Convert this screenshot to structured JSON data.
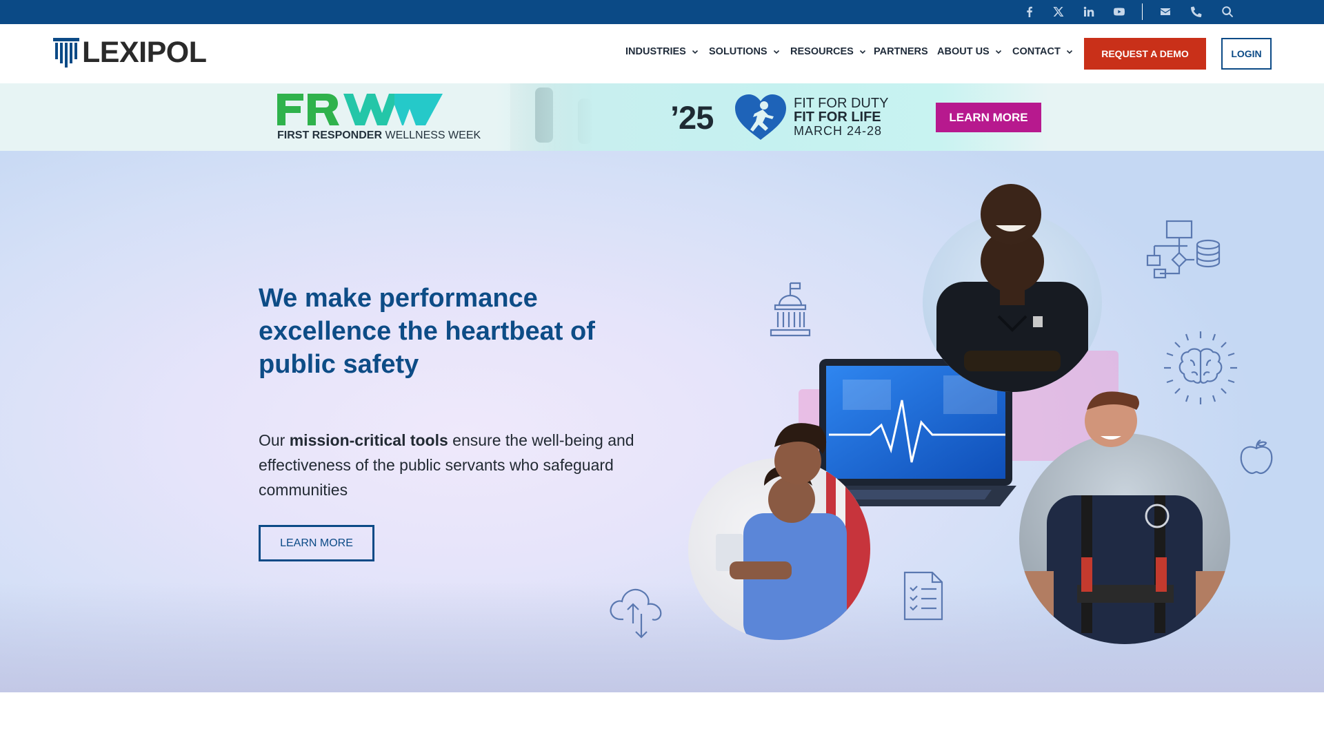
{
  "topbar": {
    "icons": [
      "facebook-icon",
      "x-icon",
      "linkedin-icon",
      "youtube-icon",
      "email-icon",
      "phone-icon",
      "search-icon"
    ],
    "background_color": "#0b4a86"
  },
  "header": {
    "logo_text": "LEXIPOL",
    "nav": [
      {
        "label": "INDUSTRIES",
        "has_dropdown": true
      },
      {
        "label": "SOLUTIONS",
        "has_dropdown": true
      },
      {
        "label": "RESOURCES",
        "has_dropdown": true
      },
      {
        "label": "PARTNERS",
        "has_dropdown": false
      },
      {
        "label": "ABOUT US",
        "has_dropdown": true
      },
      {
        "label": "CONTACT",
        "has_dropdown": true
      }
    ],
    "request_demo_label": "REQUEST A DEMO",
    "login_label": "LOGIN",
    "demo_color": "#c93019"
  },
  "promo": {
    "frww_sub_bold": "FIRST RESPONDER",
    "frww_sub_rest": " WELLNESS WEEK",
    "year": "’25",
    "line1": "FIT FOR DUTY",
    "line2": "FIT FOR LIFE",
    "line3": "MARCH 24-28",
    "button_label": "LEARN MORE",
    "button_color": "#b7198e"
  },
  "hero": {
    "headline": "We make performance excellence the heartbeat of public safety",
    "lead_pre": "Our ",
    "lead_bold": "mission-critical tools",
    "lead_post": " ensure the well-being and effectiveness of the public servants who safeguard communities",
    "button_label": "LEARN MORE",
    "accent_color": "#0d4c86"
  }
}
